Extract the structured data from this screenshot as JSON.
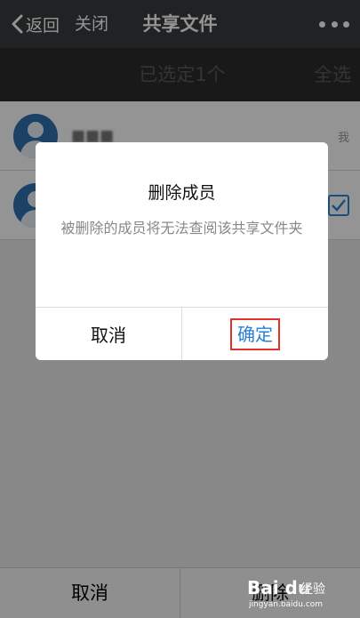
{
  "navbar": {
    "back_label": "返回",
    "close_label": "关闭",
    "title": "共享文件",
    "more_icon": "more-dots-icon"
  },
  "select_bar": {
    "count_label": "已选定1个",
    "select_all_label": "全选"
  },
  "members": [
    {
      "name": "■■■",
      "tag": "我",
      "selected": false
    },
    {
      "name": "",
      "tag": "",
      "selected": true
    }
  ],
  "bottom_bar": {
    "cancel_label": "取消",
    "delete_label": "删除"
  },
  "dialog": {
    "title": "删除成员",
    "message": "被删除的成员将无法查阅该共享文件夹",
    "cancel_label": "取消",
    "confirm_label": "确定",
    "highlight_color": "#e0342b",
    "accent_color": "#2a7fd4"
  },
  "watermark": {
    "brand": "Bai du",
    "text": "经验",
    "url": "jingyan.baidu.com"
  }
}
